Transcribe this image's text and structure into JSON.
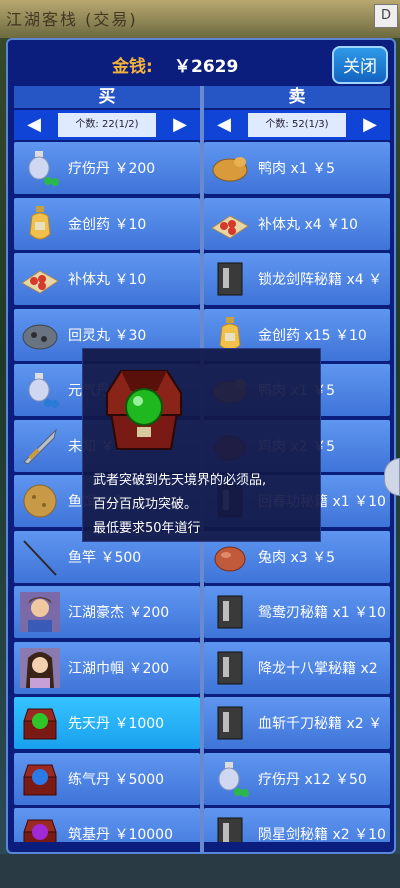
{
  "top": {
    "title_text": "江湖客栈 (交易)",
    "corner_label": "D"
  },
  "money": {
    "label": "金钱:",
    "value": "￥2629"
  },
  "close_label": "关闭",
  "buy": {
    "header": "买",
    "prev": "◀",
    "next": "▶",
    "count": "个数: 22(1/2)",
    "items": [
      {
        "name": "疗伤丹 ￥200",
        "icon": "potion-bottle-icon"
      },
      {
        "name": "金创药 ￥10",
        "icon": "gold-vase-icon"
      },
      {
        "name": "补体丸 ￥10",
        "icon": "pill-tray-icon"
      },
      {
        "name": "回灵丸 ￥30",
        "icon": "spirit-stone-icon"
      },
      {
        "name": "元气丹 ￥5",
        "icon": "potion-bottle-icon"
      },
      {
        "name": "未知 ￥5",
        "icon": "sword-icon"
      },
      {
        "name": "鱼饵 ￥5",
        "icon": "bait-icon"
      },
      {
        "name": "鱼竿 ￥500",
        "icon": "fishing-rod-icon"
      },
      {
        "name": "江湖豪杰 ￥200",
        "icon": "hero-portrait-icon"
      },
      {
        "name": "江湖巾帼 ￥200",
        "icon": "heroine-portrait-icon"
      },
      {
        "name": "先天丹 ￥1000",
        "icon": "green-orb-chest-icon"
      },
      {
        "name": "练气丹 ￥5000",
        "icon": "blue-orb-chest-icon"
      },
      {
        "name": "筑基丹 ￥10000",
        "icon": "purple-orb-chest-icon"
      }
    ]
  },
  "sell": {
    "header": "卖",
    "prev": "◀",
    "next": "▶",
    "count": "个数: 52(1/3)",
    "items": [
      {
        "name": "鸭肉 x1 ￥5",
        "icon": "roast-duck-icon"
      },
      {
        "name": "补体丸 x4 ￥10",
        "icon": "pill-tray-icon"
      },
      {
        "name": "锁龙剑阵秘籍 x4 ￥",
        "icon": "book-icon"
      },
      {
        "name": "金创药 x15 ￥10",
        "icon": "gold-vase-icon"
      },
      {
        "name": "鸭肉 x1 ￥5",
        "icon": "roast-duck-icon"
      },
      {
        "name": "鸡肉 x2 ￥5",
        "icon": "meat-icon"
      },
      {
        "name": "回春功秘籍 x1 ￥10",
        "icon": "book-icon"
      },
      {
        "name": "兔肉 x3 ￥5",
        "icon": "meat-icon"
      },
      {
        "name": "鸳鸯刃秘籍 x1 ￥10",
        "icon": "book-icon"
      },
      {
        "name": "降龙十八掌秘籍 x2",
        "icon": "book-icon"
      },
      {
        "name": "血斩千刀秘籍 x2 ￥",
        "icon": "book-icon"
      },
      {
        "name": "疗伤丹 x12 ￥50",
        "icon": "potion-bottle-icon"
      },
      {
        "name": "陨星剑秘籍 x2 ￥10",
        "icon": "book-icon"
      }
    ]
  },
  "tooltip": {
    "icon": "green-orb-chest-icon",
    "lines": [
      "武者突破到先天境界的必须品,",
      "百分百成功突破。",
      "最低要求50年道行"
    ]
  },
  "colors": {
    "panel": "#0b1e7e",
    "item": "#4f86e6",
    "selected": "#1aa0ee",
    "gold": "#f3b13a"
  }
}
